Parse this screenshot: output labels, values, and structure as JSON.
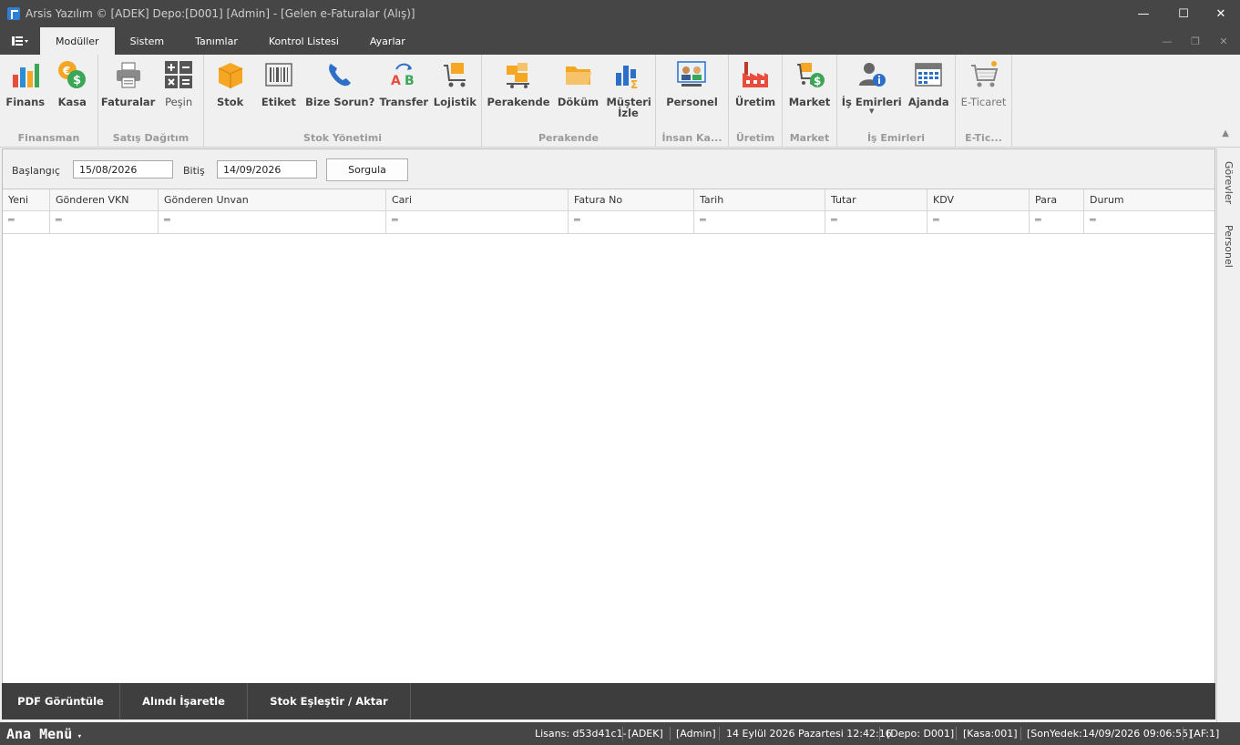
{
  "window": {
    "title": "Arsis Yazılım © [ADEK] Depo:[D001] [Admin] - [Gelen e-Faturalar (Alış)]",
    "controls": [
      "—",
      "☐",
      "✕"
    ]
  },
  "menubar": {
    "tabs": [
      "Modüller",
      "Sistem",
      "Tanımlar",
      "Kontrol Listesi",
      "Ayarlar"
    ],
    "active_tab": "Modüller"
  },
  "ribbon": {
    "groups": [
      {
        "label": "Finansman",
        "buttons": [
          "Finans",
          "Kasa"
        ]
      },
      {
        "label": "Satış Dağıtım",
        "buttons": [
          "Faturalar",
          "Peşin"
        ]
      },
      {
        "label": "Stok Yönetimi",
        "buttons": [
          "Stok",
          "Etiket",
          "Bize Sorun?",
          "Transfer",
          "Lojistik"
        ]
      },
      {
        "label": "Perakende",
        "buttons": [
          "Perakende",
          "Döküm",
          "Müşteri İzle"
        ]
      },
      {
        "label": "İnsan Ka...",
        "buttons": [
          "Personel"
        ]
      },
      {
        "label": "Üretim",
        "buttons": [
          "Üretim"
        ]
      },
      {
        "label": "Market",
        "buttons": [
          "Market"
        ]
      },
      {
        "label": "İş Emirleri",
        "buttons": [
          "İş Emirleri",
          "Ajanda"
        ]
      },
      {
        "label": "E-Tic...",
        "buttons": [
          "E-Ticaret"
        ]
      }
    ]
  },
  "filter": {
    "start_label": "Başlangıç",
    "start_value": "15/08/2026",
    "end_label": "Bitiş",
    "end_value": "14/09/2026",
    "query_button": "Sorgula"
  },
  "grid": {
    "columns": [
      "Yeni",
      "Gönderen VKN",
      "Gönderen Unvan",
      "Cari",
      "Fatura No",
      "Tarih",
      "Tutar",
      "KDV",
      "Para",
      "Durum"
    ],
    "filter_symbol": "═"
  },
  "actions": {
    "pdf": "PDF Görüntüle",
    "received": "Alındı İşaretle",
    "match": "Stok Eşleştir / Aktar"
  },
  "side_tabs": [
    "Görevler",
    "Personel"
  ],
  "status": {
    "menu": "Ana Menü",
    "license": "Lisans: d53d41c1-",
    "company": "[ADEK]",
    "user": "[Admin]",
    "datetime": "14 Eylül 2026 Pazartesi 12:42:16",
    "depot": "[Depo: D001]",
    "kasa": "[Kasa:001]",
    "backup": "[SonYedek:14/09/2026 09:06:55]",
    "af": "[AF:1]"
  }
}
